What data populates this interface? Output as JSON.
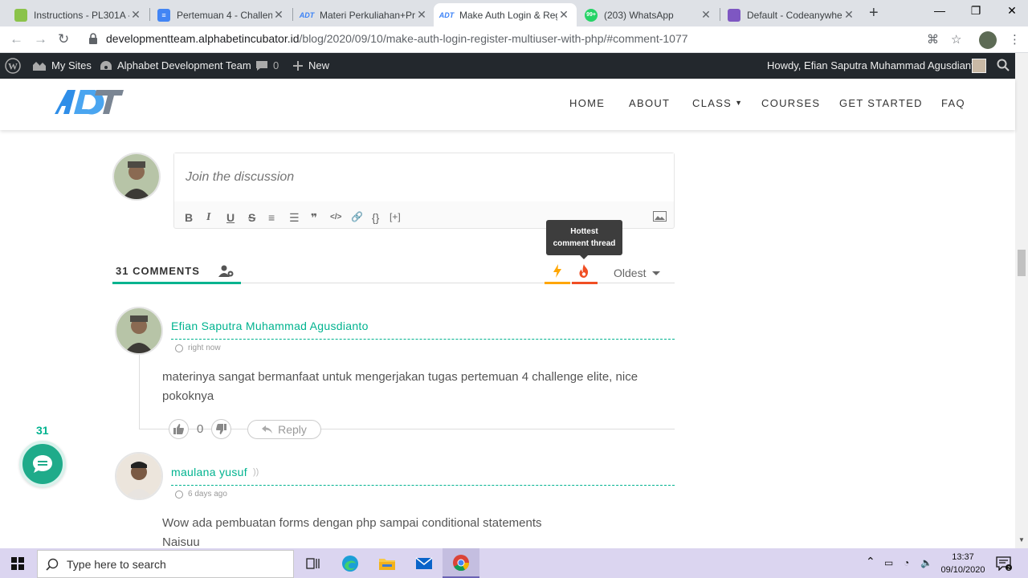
{
  "browser": {
    "tabs": [
      {
        "title": "Instructions - PL301A - ",
        "favicon_color": "#8bc34a"
      },
      {
        "title": "Pertemuan 4 - Challeng",
        "favicon_color": "#4285f4"
      },
      {
        "title": "Materi Perkuliahan+Pra",
        "favicon_color": "#3b82f6"
      },
      {
        "title": "Make Auth Login & Reg",
        "favicon_color": "#3b82f6"
      },
      {
        "title": "(203) WhatsApp",
        "favicon_color": "#25d366"
      },
      {
        "title": "Default - Codeanywhere",
        "favicon_color": "#7e57c2"
      }
    ],
    "whatsapp_badge": "99+",
    "url_host": "developmentteam.alphabetincubator.id",
    "url_path": "/blog/2020/09/10/make-auth-login-register-multiuser-with-php/#comment-1077"
  },
  "wpbar": {
    "my_sites": "My Sites",
    "site_name": "Alphabet Development Team",
    "comments_count": "0",
    "new_label": "New",
    "howdy": "Howdy, Efian Saputra Muhammad Agusdianto"
  },
  "site": {
    "logo_text": "ADT",
    "menu": [
      "HOME",
      "ABOUT",
      "CLASS",
      "COURSES",
      "GET STARTED",
      "FAQ"
    ]
  },
  "discussion": {
    "placeholder": "Join the discussion",
    "toolbar": [
      "B",
      "I",
      "U",
      "S",
      "≡",
      "☰",
      "❞",
      "</>",
      "🔗",
      "{}",
      "[+]"
    ],
    "tooltip_line1": "Hottest",
    "tooltip_line2": "comment thread",
    "comments_label": "31 COMMENTS",
    "sort_label": "Oldest"
  },
  "comments": [
    {
      "author": "Efian Saputra Muhammad Agusdianto",
      "time": "right now",
      "text": "materinya sangat bermanfaat untuk mengerjakan tugas pertemuan 4 challenge elite, nice pokoknya",
      "votes": "0",
      "reply_label": "Reply"
    },
    {
      "author": "maulana yusuf",
      "time": "6 days ago",
      "text_line1": "Wow ada pembuatan forms dengan php sampai conditional statements",
      "text_line2": "Naisuu"
    }
  ],
  "bubble": {
    "count": "31"
  },
  "taskbar": {
    "search_placeholder": "Type here to search",
    "time": "13:37",
    "date": "09/10/2020",
    "notif_count": "2"
  },
  "colors": {
    "accent": "#00b38f",
    "wp_bar": "#23282d",
    "taskbar": "#dbd5f0"
  }
}
